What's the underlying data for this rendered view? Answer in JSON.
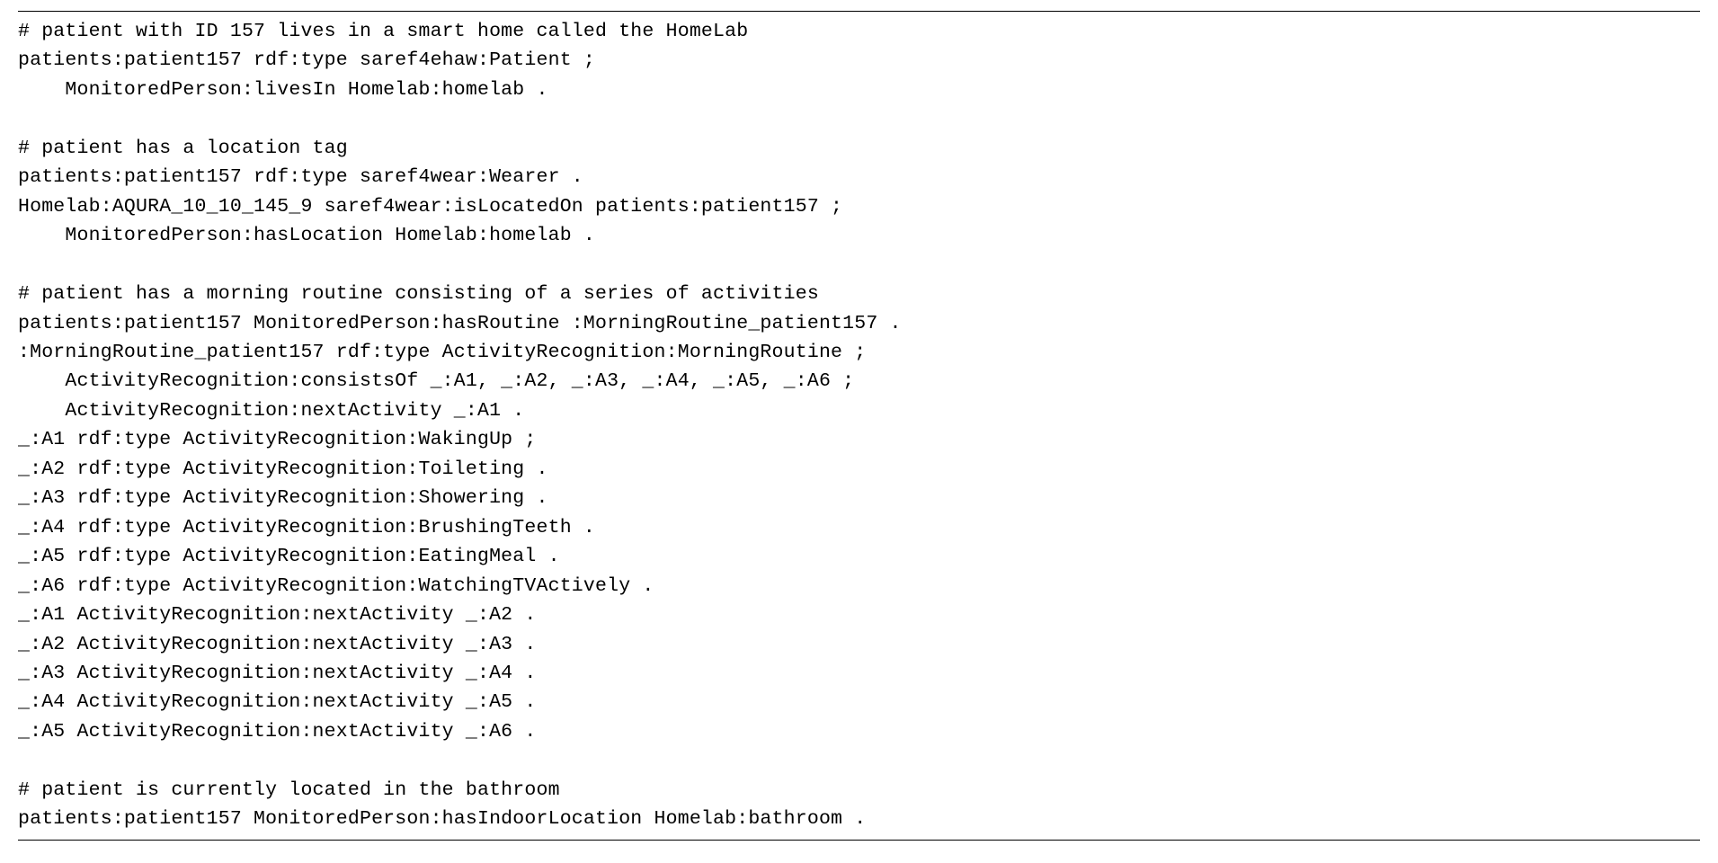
{
  "code": {
    "lines": [
      "# patient with ID 157 lives in a smart home called the HomeLab",
      "patients:patient157 rdf:type saref4ehaw:Patient ;",
      "    MonitoredPerson:livesIn Homelab:homelab .",
      "",
      "# patient has a location tag",
      "patients:patient157 rdf:type saref4wear:Wearer .",
      "Homelab:AQURA_10_10_145_9 saref4wear:isLocatedOn patients:patient157 ;",
      "    MonitoredPerson:hasLocation Homelab:homelab .",
      "",
      "# patient has a morning routine consisting of a series of activities",
      "patients:patient157 MonitoredPerson:hasRoutine :MorningRoutine_patient157 .",
      ":MorningRoutine_patient157 rdf:type ActivityRecognition:MorningRoutine ;",
      "    ActivityRecognition:consistsOf _:A1, _:A2, _:A3, _:A4, _:A5, _:A6 ;",
      "    ActivityRecognition:nextActivity _:A1 .",
      "_:A1 rdf:type ActivityRecognition:WakingUp ;",
      "_:A2 rdf:type ActivityRecognition:Toileting .",
      "_:A3 rdf:type ActivityRecognition:Showering .",
      "_:A4 rdf:type ActivityRecognition:BrushingTeeth .",
      "_:A5 rdf:type ActivityRecognition:EatingMeal .",
      "_:A6 rdf:type ActivityRecognition:WatchingTVActively .",
      "_:A1 ActivityRecognition:nextActivity _:A2 .",
      "_:A2 ActivityRecognition:nextActivity _:A3 .",
      "_:A3 ActivityRecognition:nextActivity _:A4 .",
      "_:A4 ActivityRecognition:nextActivity _:A5 .",
      "_:A5 ActivityRecognition:nextActivity _:A6 .",
      "",
      "# patient is currently located in the bathroom",
      "patients:patient157 MonitoredPerson:hasIndoorLocation Homelab:bathroom ."
    ]
  }
}
